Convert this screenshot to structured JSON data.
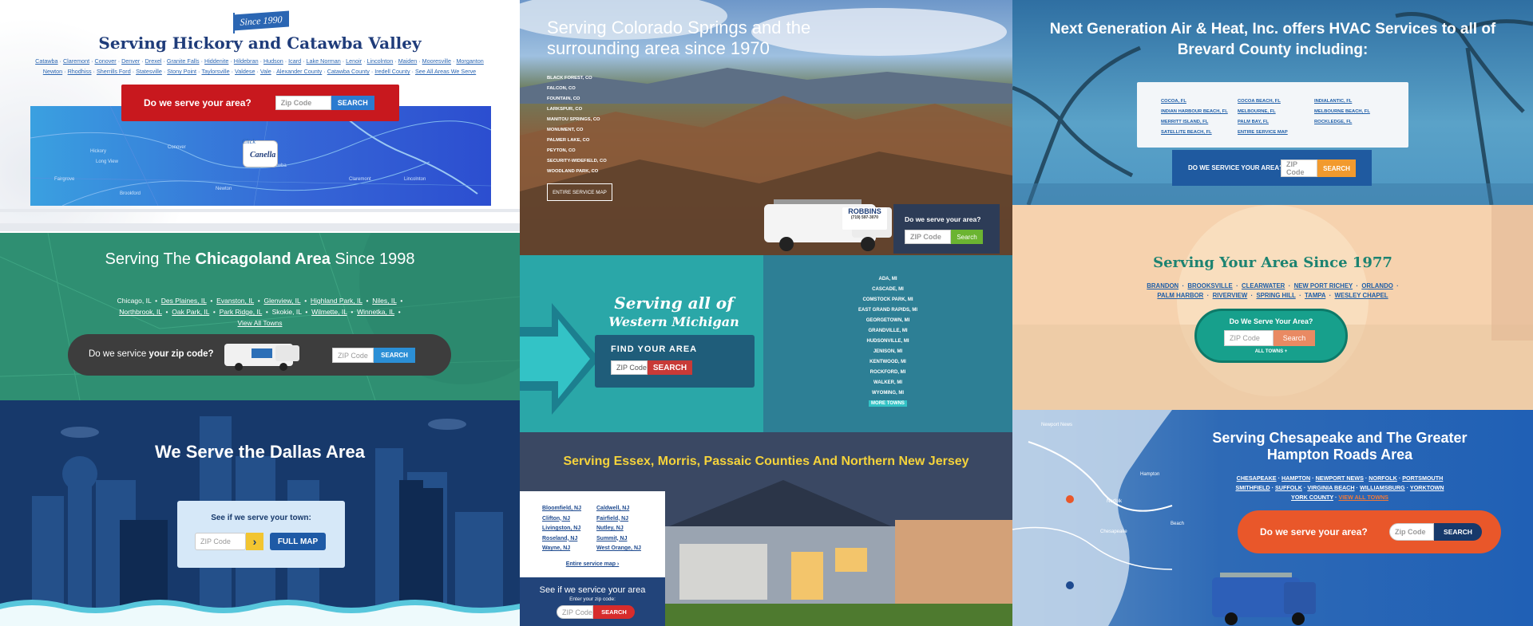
{
  "hickory": {
    "badge": "Since 1990",
    "title": "Serving Hickory and Catawba Valley",
    "links_row1": [
      "Catawba",
      "Claremont",
      "Conover",
      "Denver",
      "Drexel",
      "Granite Falls",
      "Hiddenite",
      "Hildebran",
      "Hudson",
      "Icard",
      "Lake Norman",
      "Lenoir",
      "Lincolnton",
      "Maiden",
      "Mooresville",
      "Morganton"
    ],
    "links_row2": [
      "Newton",
      "Rhodhiss",
      "Sherrills Ford",
      "Statesville",
      "Stony Point",
      "Taylorsville",
      "Valdese",
      "Vale",
      "Alexander County",
      "Catawba County",
      "Iredell County",
      "See All Areas We Serve"
    ],
    "cta": "Do we serve your area?",
    "zip_placeholder": "Zip Code",
    "search": "SEARCH",
    "click_label": "Click",
    "logo": "Canella",
    "map_labels": [
      "Hickory",
      "Long View",
      "Brookford",
      "Conover",
      "Newton",
      "Catawba",
      "Claremont",
      "Lincolnton",
      "Fairgrove"
    ]
  },
  "chicago": {
    "title_pre": "Serving The ",
    "title_bold": "Chicagoland Area",
    "title_post": " Since 1998",
    "row1": [
      "Chicago, IL",
      "Des Plaines, IL",
      "Evanston, IL",
      "Glenview, IL",
      "Highland Park, IL",
      "Niles, IL"
    ],
    "row2": [
      "Northbrook, IL",
      "Oak Park, IL",
      "Park Ridge, IL",
      "Skokie, IL",
      "Wilmette, IL",
      "Winnetka, IL"
    ],
    "all": "View All Towns",
    "cta_pre": "Do we service ",
    "cta_bold": "your zip code?",
    "zip_placeholder": "ZIP Code",
    "search": "SEARCH"
  },
  "dallas": {
    "title": "We Serve the Dallas Area",
    "prompt": "See if we serve your town:",
    "zip_placeholder": "ZIP Code",
    "go": "›",
    "full_map": "FULL MAP"
  },
  "colorado": {
    "title": "Serving Colorado Springs and the surrounding area since 1970",
    "towns": [
      "BLACK FOREST, CO",
      "FALCON, CO",
      "FOUNTAIN, CO",
      "LARKSPUR, CO",
      "MANITOU SPRINGS, CO",
      "MONUMENT, CO",
      "PALMER LAKE, CO",
      "PEYTON, CO",
      "SECURITY-WIDEFIELD, CO",
      "WOODLAND PARK, CO"
    ],
    "map_btn": "ENTIRE SERVICE MAP",
    "cta": "Do we serve your area?",
    "zip_placeholder": "ZIP Code",
    "search": "Search",
    "van_brand": "ROBBINS",
    "van_phone": "(719) 597-3070"
  },
  "michigan": {
    "serving": "Serving all of",
    "region": "Western Michigan",
    "find": "FIND YOUR AREA",
    "zip_placeholder": "ZIP Code",
    "search": "SEARCH",
    "towns": [
      "ADA, MI",
      "CASCADE, MI",
      "COMSTOCK PARK, MI",
      "EAST GRAND RAPIDS, MI",
      "GEORGETOWN, MI",
      "GRANDVILLE, MI",
      "HUDSONVILLE, MI",
      "JENISON, MI",
      "KENTWOOD, MI",
      "ROCKFORD, MI",
      "WALKER, MI",
      "WYOMING, MI"
    ],
    "more": "MORE TOWNS"
  },
  "nj": {
    "title": "Serving Essex, Morris, Passaic Counties And Northern New Jersey",
    "col1": [
      "Bloomfield, NJ",
      "Clifton, NJ",
      "Livingston, NJ",
      "Roseland, NJ",
      "Wayne, NJ"
    ],
    "col2": [
      "Caldwell, NJ",
      "Fairfield, NJ",
      "Nutley, NJ",
      "Summit, NJ",
      "West Orange, NJ"
    ],
    "entire": "Entire service map ›",
    "cta": "See if we service your area",
    "prompt": "Enter your zip code:",
    "zip_placeholder": "ZIP Code",
    "search": "SEARCH"
  },
  "brevard": {
    "title": "Next Generation Air & Heat, Inc. offers HVAC Services to all of Brevard County including:",
    "col1": [
      "COCOA, FL",
      "INDIAN HARBOUR BEACH, FL",
      "MERRITT ISLAND, FL",
      "SATELLITE BEACH, FL"
    ],
    "col2": [
      "COCOA BEACH, FL",
      "MELBOURNE, FL",
      "PALM BAY, FL",
      "ENTIRE SERVICE MAP"
    ],
    "col3": [
      "INDIALANTIC, FL",
      "MELBOURNE BEACH, FL",
      "ROCKLEDGE, FL"
    ],
    "cta": "DO WE SERVICE YOUR AREA?",
    "zip_placeholder": "ZIP Code",
    "search": "SEARCH"
  },
  "brandon": {
    "title": "Serving Your Area Since 1977",
    "row1": [
      "BRANDON",
      "BROOKSVILLE",
      "CLEARWATER",
      "NEW PORT RICHEY",
      "ORLANDO"
    ],
    "row2": [
      "PALM HARBOR",
      "RIVERVIEW",
      "SPRING HILL",
      "TAMPA",
      "WESLEY CHAPEL"
    ],
    "cta": "Do We Serve Your Area?",
    "zip_placeholder": "ZIP Code",
    "search": "Search",
    "all": "ALL TOWNS +"
  },
  "chesapeake": {
    "title": "Serving Chesapeake and The Greater Hampton Roads Area",
    "row1": [
      "CHESAPEAKE",
      "HAMPTON",
      "NEWPORT NEWS",
      "NORFOLK",
      "PORTSMOUTH"
    ],
    "row2": [
      "SMITHFIELD",
      "SUFFOLK",
      "VIRGINIA BEACH",
      "WILLIAMSBURG",
      "YORKTOWN"
    ],
    "row3": [
      "YORK COUNTY"
    ],
    "all": "VIEW ALL TOWNS",
    "cta": "Do we serve your area?",
    "zip_placeholder": "Zip Code",
    "search": "SEARCH",
    "map_labels": [
      "Newport News",
      "Hampton",
      "Norfolk",
      "Chesapeake",
      "Beach"
    ]
  }
}
